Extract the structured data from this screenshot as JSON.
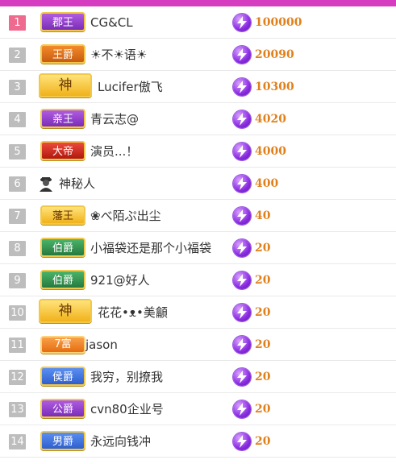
{
  "rows": [
    {
      "rank": "1",
      "badge": "郡王",
      "name": "CG&CL",
      "value": "100000"
    },
    {
      "rank": "2",
      "badge": "王爵",
      "name": "☀不☀语☀",
      "value": "20090"
    },
    {
      "rank": "3",
      "badge": "神",
      "name": "Lucifer傲飞",
      "value": "10300"
    },
    {
      "rank": "4",
      "badge": "亲王",
      "name": "青云志@",
      "value": "4020"
    },
    {
      "rank": "5",
      "badge": "大帝",
      "name": "演员...！",
      "value": "4000"
    },
    {
      "rank": "6",
      "badge": "",
      "name": "神秘人",
      "value": "400"
    },
    {
      "rank": "7",
      "badge": "藩王",
      "name": "❀べ陌ぷ出尘",
      "value": "40"
    },
    {
      "rank": "8",
      "badge": "伯爵",
      "name": "小福袋还是那个小福袋",
      "value": "20"
    },
    {
      "rank": "9",
      "badge": "伯爵",
      "name": "921@好人",
      "value": "20"
    },
    {
      "rank": "10",
      "badge": "神",
      "name": "花花•ᴥ•美龥",
      "value": "20"
    },
    {
      "rank": "11",
      "badge": "7富",
      "name": "jason",
      "value": "20"
    },
    {
      "rank": "12",
      "badge": "侯爵",
      "name": "我穷，别撩我",
      "value": "20"
    },
    {
      "rank": "13",
      "badge": "公爵",
      "name": "cvn80企业号",
      "value": "20"
    },
    {
      "rank": "14",
      "badge": "男爵",
      "name": "永远向钱冲",
      "value": "20"
    }
  ],
  "colors": {
    "topbar": "#d63cbf",
    "rank_first": "#ef6a8f",
    "rank_other": "#bdbdbd",
    "value": "#e0801a"
  },
  "icons": {
    "value_icon": "lightning-bolt-icon",
    "mystery_icon": "mystery-person-icon"
  }
}
